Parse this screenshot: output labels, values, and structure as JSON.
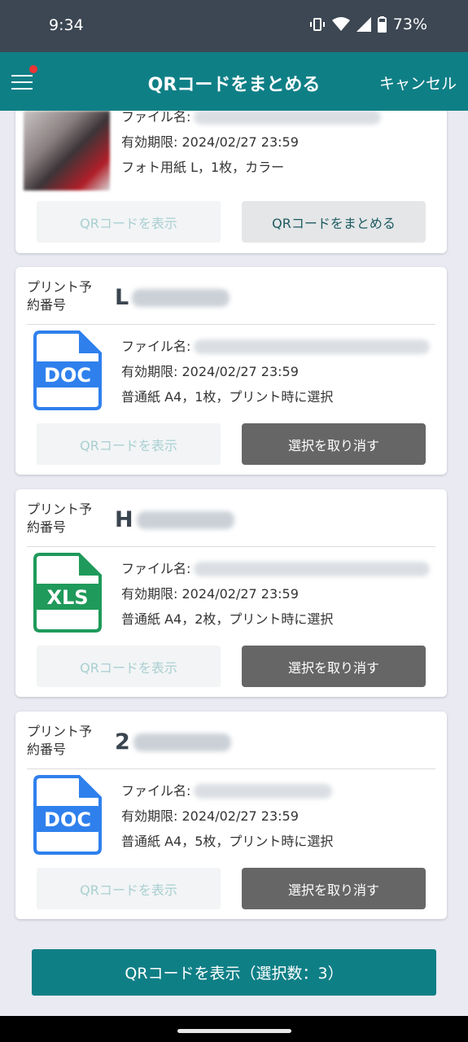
{
  "status_bar": {
    "time": "9:34",
    "battery": "73%"
  },
  "app_bar": {
    "title": "QRコードをまとめる",
    "cancel_label": "キャンセル"
  },
  "labels": {
    "reservation_number": "プリント予約番号",
    "file_name": "ファイル名:",
    "show_qr": "QRコードを表示",
    "merge_qr": "QRコードをまとめる",
    "deselect": "選択を取り消す"
  },
  "cards": [
    {
      "type": "photo",
      "expiry": "有効期限: 2024/02/27 23:59",
      "spec": "フォト用紙 L，1枚，カラー",
      "action": "QRコードをまとめる"
    },
    {
      "type": "DOC",
      "number_prefix": "L",
      "expiry": "有効期限: 2024/02/27 23:59",
      "spec": "普通紙 A4，1枚，プリント時に選択",
      "action": "選択を取り消す"
    },
    {
      "type": "XLS",
      "number_prefix": "H",
      "expiry": "有効期限: 2024/02/27 23:59",
      "spec": "普通紙 A4，2枚，プリント時に選択",
      "action": "選択を取り消す"
    },
    {
      "type": "DOC",
      "number_prefix": "2",
      "expiry": "有効期限: 2024/02/27 23:59",
      "spec": "普通紙 A4，5枚，プリント時に選択",
      "action": "選択を取り消す"
    }
  ],
  "bottom_button": {
    "label": "QRコードを表示（選択数：3）"
  },
  "colors": {
    "accent": "#0f7f86",
    "doc_icon": "#2f80ed",
    "xls_icon": "#1f9a5a",
    "deselect_bg": "#666666"
  },
  "icons": [
    "menu-icon",
    "notification-dot-icon",
    "vibrate-icon",
    "wifi-icon",
    "signal-icon",
    "battery-icon",
    "doc-file-icon",
    "xls-file-icon"
  ]
}
